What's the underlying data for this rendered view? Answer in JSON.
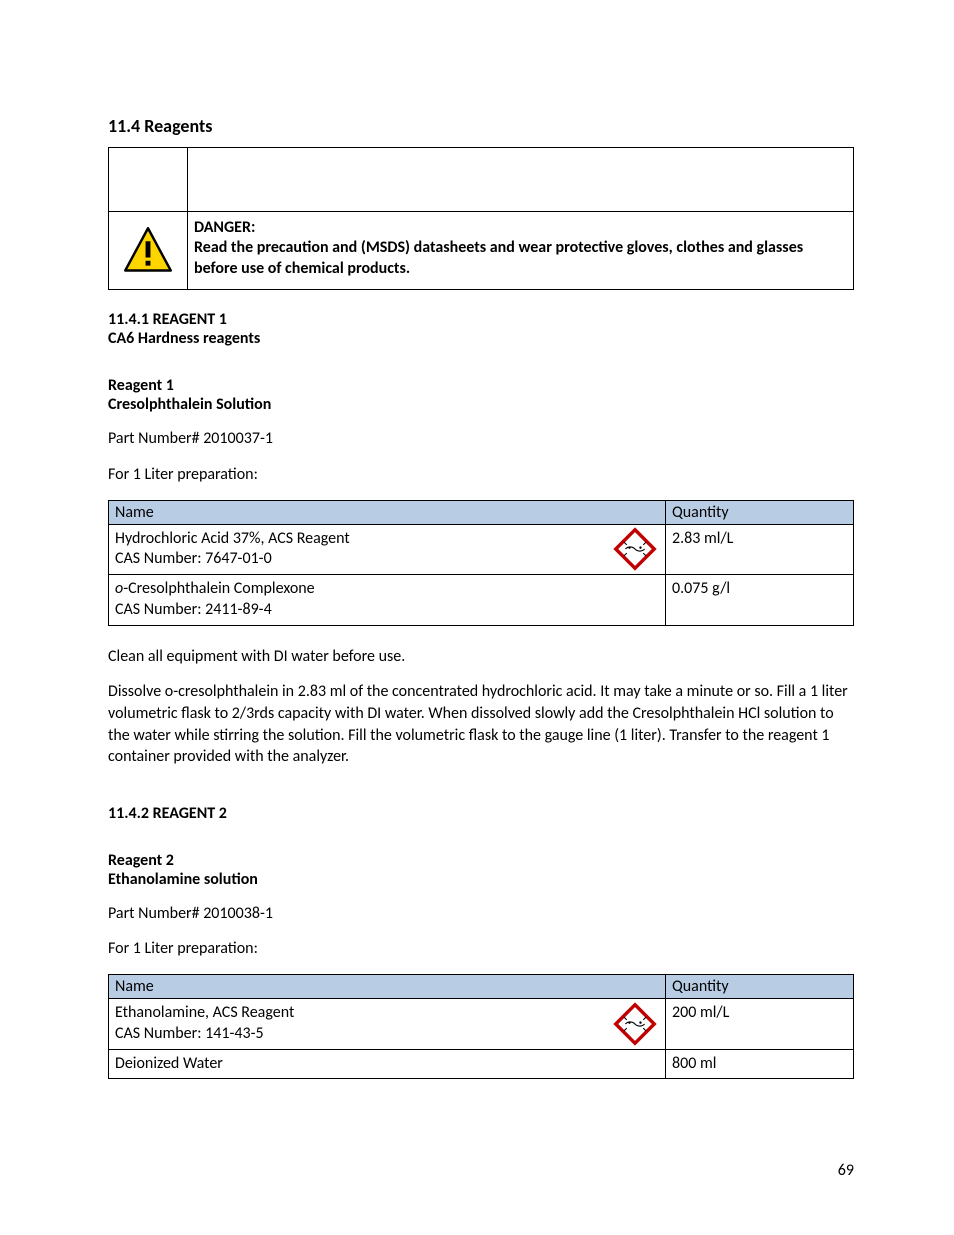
{
  "section": {
    "heading": "11.4 Reagents",
    "danger_label": "DANGER:",
    "danger_text": "Read the precaution and (MSDS) datasheets and wear protective gloves, clothes and glasses before use of chemical products."
  },
  "reagent1": {
    "section_number": "11.4.1 REAGENT 1",
    "subtitle": "CA6 Hardness reagents",
    "label": "Reagent 1",
    "name": "Cresolphthalein Solution",
    "part_number": "Part Number# 2010037-1",
    "prep_note": "For 1 Liter preparation:",
    "table": {
      "header_name": "Name",
      "header_qty": "Quantity",
      "rows": [
        {
          "line1": "Hydrochloric Acid 37%, ACS Reagent",
          "line2": "CAS Number: 7647-01-0",
          "hazard": true,
          "qty": "2.83 ml/L"
        },
        {
          "line1_prefix": "o",
          "line1_rest": "-Cresolphthalein Complexone",
          "line2": "CAS Number: 2411-89-4",
          "hazard": false,
          "qty": "0.075 g/l"
        }
      ]
    },
    "instructions1": "Clean all equipment with DI water before use.",
    "instructions2": "Dissolve o-cresolphthalein in 2.83 ml of the concentrated hydrochloric acid. It may take a minute or so. Fill a 1 liter volumetric flask to 2/3rds capacity with DI water. When dissolved slowly add the Cresolphthalein HCl solution to the water while stirring the solution. Fill the volumetric flask to the gauge line (1 liter). Transfer to the reagent 1 container provided with the analyzer."
  },
  "reagent2": {
    "section_number": "11.4.2 REAGENT 2",
    "label": "Reagent 2",
    "name": "Ethanolamine solution",
    "part_number": "Part Number# 2010038-1",
    "prep_note": "For 1 Liter preparation:",
    "table": {
      "header_name": "Name",
      "header_qty": "Quantity",
      "rows": [
        {
          "line1": "Ethanolamine, ACS Reagent",
          "line2": "CAS Number: 141-43-5",
          "hazard": true,
          "qty": "200 ml/L"
        },
        {
          "line1": "Deionized Water",
          "line2": "",
          "hazard": false,
          "qty": "800 ml"
        }
      ]
    }
  },
  "page_number": "69"
}
